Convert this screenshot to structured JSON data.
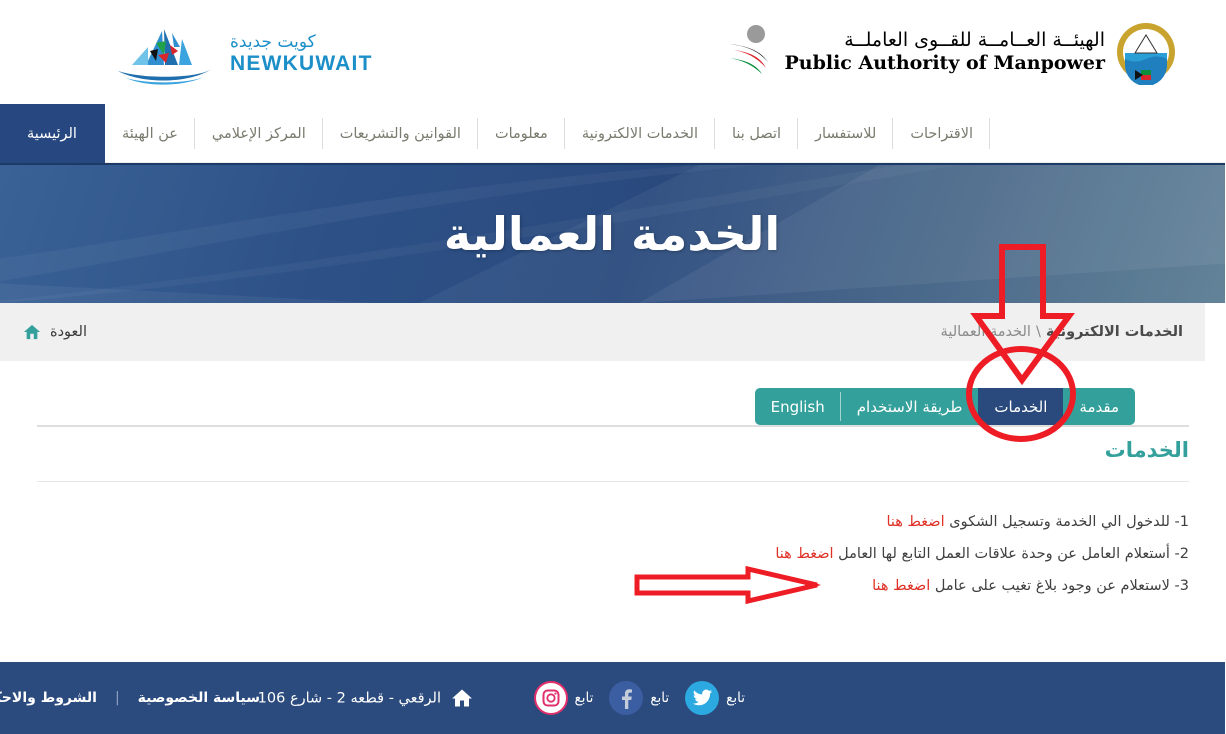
{
  "brand": {
    "left_logo": {
      "arabic": "كويت جديدة",
      "english": "NEWKUWAIT",
      "color": "#1c8fc9"
    },
    "right_logo": {
      "arabic": "الهيئــة العــامــة للقــوى العاملــة",
      "english": "Public Authority of Manpower"
    }
  },
  "nav": {
    "items": [
      {
        "label": "الرئيسية",
        "active": true
      },
      {
        "label": "عن الهيئة",
        "active": false
      },
      {
        "label": "المركز الإعلامي",
        "active": false
      },
      {
        "label": "القوانين والتشريعات",
        "active": false
      },
      {
        "label": "معلومات",
        "active": false
      },
      {
        "label": "الخدمات الالكترونية",
        "active": false
      },
      {
        "label": "اتصل بنا",
        "active": false
      },
      {
        "label": "للاستفسار",
        "active": false
      },
      {
        "label": "الاقتراحات",
        "active": false
      }
    ],
    "active_color": "#26477f"
  },
  "hero": {
    "title": "الخدمة العمالية",
    "background_color": "#2a4a7e"
  },
  "breadcrumb": {
    "current": "الخدمات الالكترونية",
    "separator": "\\",
    "parent": "الخدمة العمالية",
    "back_label": "العودة",
    "home_icon": "home-icon",
    "home_icon_color": "#33a09b"
  },
  "tabs": {
    "items": [
      {
        "label": "مقدمة",
        "active": false
      },
      {
        "label": "الخدمات",
        "active": true
      },
      {
        "label": "طريقة الاستخدام",
        "active": false
      },
      {
        "label": "English",
        "active": false
      }
    ],
    "inactive_color": "#33a09b",
    "active_color": "#2a4a7e"
  },
  "content": {
    "section_title": "الخدمات",
    "services": [
      {
        "number": "1-",
        "text": "للدخول الي الخدمة وتسجيل الشكوى",
        "link": "اضغط هنا"
      },
      {
        "number": "2-",
        "text": "أستعلام العامل عن وحدة علاقات العمل التابع لها العامل",
        "link": "اضغط هنا"
      },
      {
        "number": "3-",
        "text": "لاستعلام عن وجود بلاغ تغيب على عامل",
        "link": "اضغط هنا"
      }
    ],
    "link_color": "#e03127"
  },
  "footer": {
    "privacy_label": "سياسة الخصوصية",
    "divider": "|",
    "terms_label": "الشروط والاحكام",
    "address": "الرقعي - قطعه 2 - شارع 106",
    "address_icon": "home-icon",
    "social": [
      {
        "network": "twitter-icon",
        "label": "تابع",
        "color": "#2ca9e0"
      },
      {
        "network": "facebook-icon",
        "label": "تابع",
        "color": "#4267b2"
      },
      {
        "network": "instagram-icon",
        "label": "تابع",
        "color": "#e1306c"
      }
    ],
    "background_color": "#2b4a7d"
  },
  "annotations": {
    "color": "#ee1c25",
    "down_arrow": "hollow red down arrow pointing at الخدمات tab",
    "ellipse": "red ellipse circling الخدمات tab",
    "right_arrow": "hollow red right arrow pointing at اضغط هنا in item 3"
  }
}
